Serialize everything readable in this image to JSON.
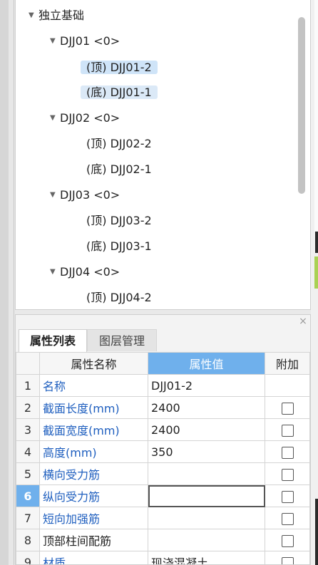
{
  "tree": {
    "root": "独立基础",
    "groups": [
      {
        "label": "DJJ01 <0>",
        "children": [
          "(顶) DJJ01-2",
          "(底) DJJ01-1"
        ]
      },
      {
        "label": "DJJ02 <0>",
        "children": [
          "(顶) DJJ02-2",
          "(底) DJJ02-1"
        ]
      },
      {
        "label": "DJJ03 <0>",
        "children": [
          "(顶) DJJ03-2",
          "(底) DJJ03-1"
        ]
      },
      {
        "label": "DJJ04 <0>",
        "children": [
          "(顶) DJJ04-2"
        ]
      }
    ],
    "expand_arrow": "▼"
  },
  "panel": {
    "close_label": "×",
    "tabs": [
      {
        "label": "属性列表",
        "active": true
      },
      {
        "label": "图层管理",
        "active": false
      }
    ]
  },
  "table": {
    "headers": [
      "",
      "属性名称",
      "属性值",
      "附加"
    ],
    "rows": [
      {
        "num": "1",
        "name": "名称",
        "value": "DJJ01-2",
        "checkbox": false
      },
      {
        "num": "2",
        "name": "截面长度(mm)",
        "value": "2400",
        "checkbox": true
      },
      {
        "num": "3",
        "name": "截面宽度(mm)",
        "value": "2400",
        "checkbox": true
      },
      {
        "num": "4",
        "name": "高度(mm)",
        "value": "350",
        "checkbox": true
      },
      {
        "num": "5",
        "name": "横向受力筋",
        "value": "",
        "checkbox": true
      },
      {
        "num": "6",
        "name": "纵向受力筋",
        "value": "",
        "checkbox": true
      },
      {
        "num": "7",
        "name": "短向加强筋",
        "value": "",
        "checkbox": true
      },
      {
        "num": "8",
        "name": "顶部柱间配筋",
        "value": "",
        "checkbox": true
      },
      {
        "num": "9",
        "name": "材质",
        "value": "现浇混凝土",
        "checkbox": true
      }
    ]
  },
  "colors": {
    "accent": "#6fb0ec",
    "selection": "#cfe4f8",
    "link_text": "#1f5fbf"
  }
}
